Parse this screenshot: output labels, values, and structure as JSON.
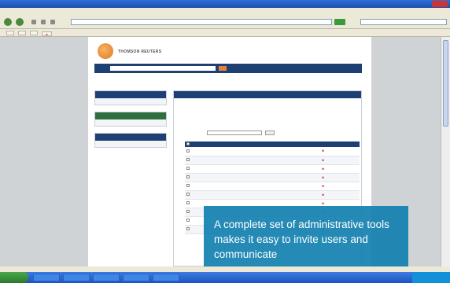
{
  "window": {
    "title": ""
  },
  "menu": {
    "items": [
      "",
      "",
      "",
      "",
      "",
      ""
    ]
  },
  "address": {
    "url": ""
  },
  "bookmarks": [
    "",
    "",
    "",
    ""
  ],
  "page": {
    "brand": "THOMSON REUTERS",
    "site_title": "",
    "search_label": "",
    "breadcrumb_label": "",
    "breadcrumb_links": [
      "",
      "",
      "",
      "",
      "",
      ""
    ]
  },
  "left": {
    "box1_title": "",
    "box1_items": [
      "",
      "",
      "",
      ""
    ],
    "box2_title": "",
    "box2_items": [
      "",
      "",
      "",
      "",
      "",
      "",
      "",
      ""
    ],
    "box3_title": "",
    "box3_items": [
      "",
      "",
      "",
      "",
      "",
      ""
    ]
  },
  "main": {
    "title": "",
    "intro": "",
    "link": "",
    "filter_label": "",
    "filter_button": "",
    "columns": [
      "",
      "",
      "",
      "",
      ""
    ],
    "rows": [
      {
        "name": "",
        "email": "",
        "location": "",
        "count": ""
      },
      {
        "name": "",
        "email": "",
        "location": "",
        "count": ""
      },
      {
        "name": "",
        "email": "",
        "location": "",
        "count": ""
      },
      {
        "name": "",
        "email": "",
        "location": "",
        "count": ""
      },
      {
        "name": "",
        "email": "",
        "location": "",
        "count": ""
      },
      {
        "name": "",
        "email": "",
        "location": "",
        "count": ""
      },
      {
        "name": "",
        "email": "",
        "location": "",
        "count": ""
      },
      {
        "name": "",
        "email": "",
        "location": "",
        "count": ""
      },
      {
        "name": "",
        "email": "",
        "location": "",
        "count": ""
      },
      {
        "name": "",
        "email": "",
        "location": "",
        "count": ""
      }
    ]
  },
  "caption": {
    "text": "A complete set of administrative tools makes it easy to invite users and communicate"
  },
  "icons": {
    "back": "back-arrow-icon",
    "forward": "forward-arrow-icon",
    "go": "go-icon",
    "delete": "delete-icon",
    "logo": "thomson-reuters-logo",
    "start": "windows-start-icon"
  },
  "colors": {
    "navy": "#1e3f73",
    "green": "#2f6e3f",
    "link": "#3a6fa8",
    "orange": "#e2823b",
    "caption": "#1280af",
    "delete": "#c0262d"
  }
}
